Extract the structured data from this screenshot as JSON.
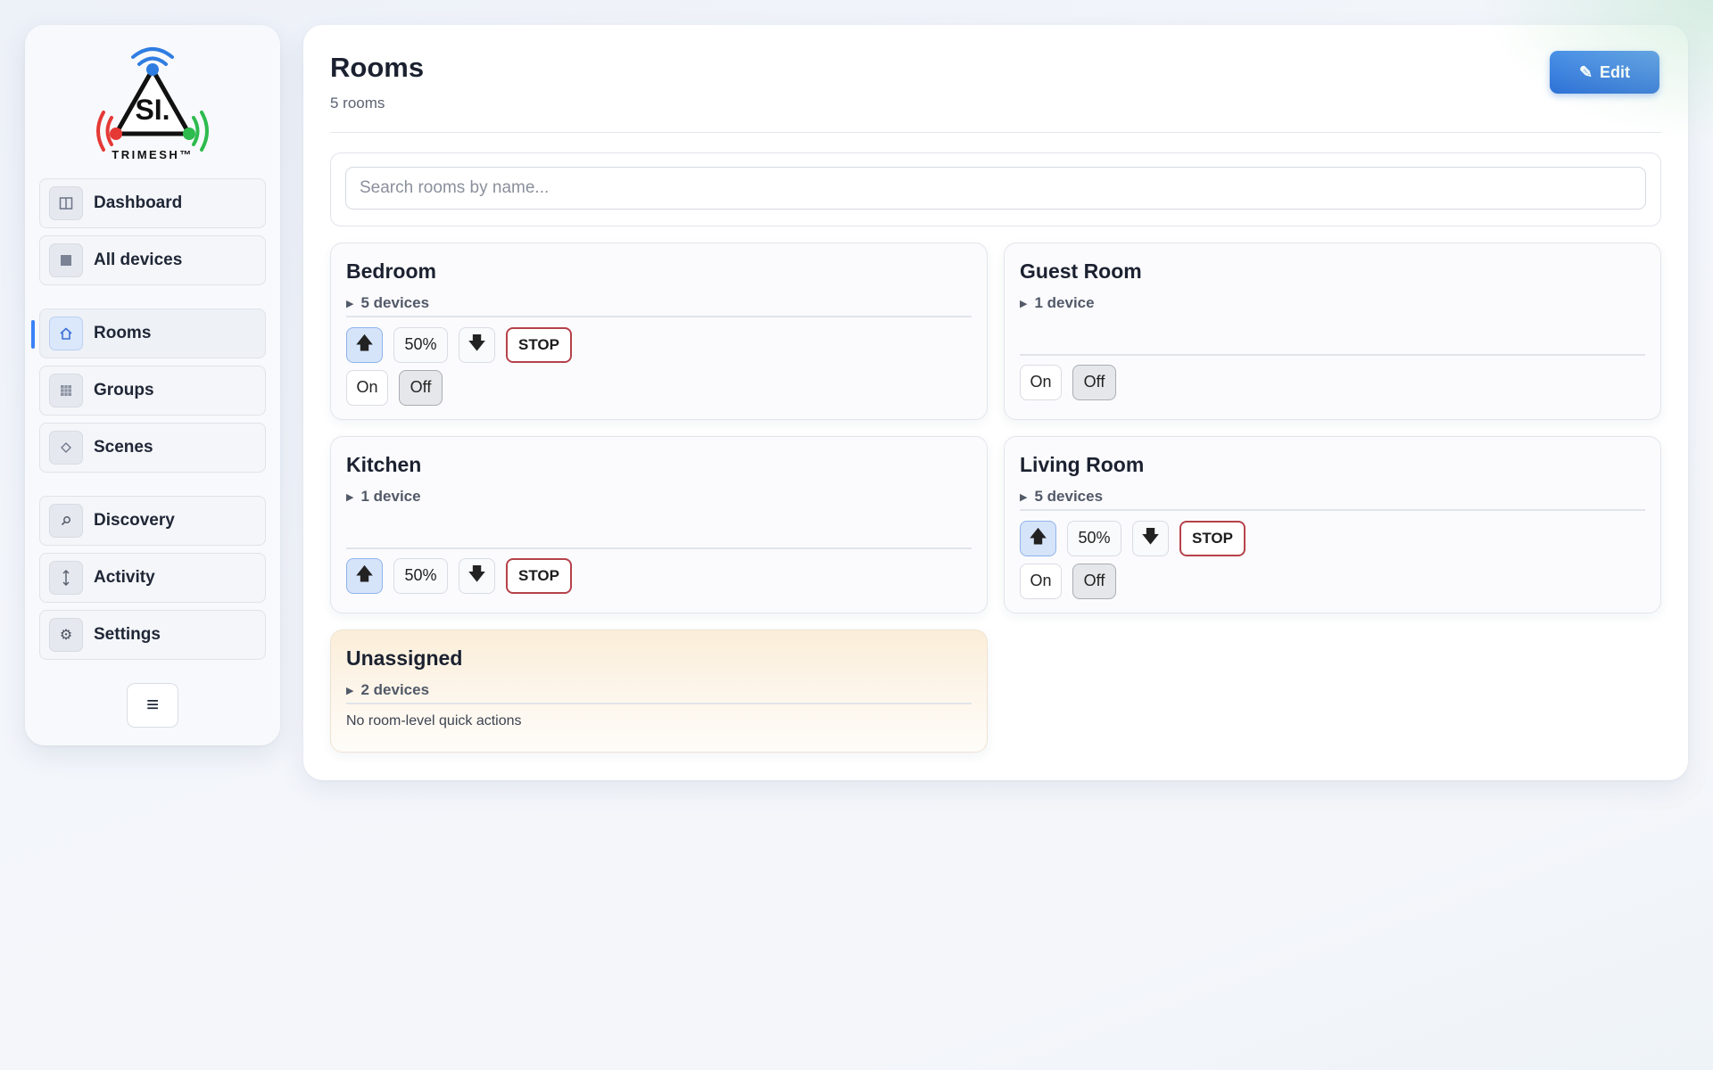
{
  "sidebar": {
    "logo_text": "SI.",
    "logo_brand": "TRIMESH™",
    "nav_primary": [
      {
        "label": "Dashboard",
        "icon": "columns-icon"
      },
      {
        "label": "All devices",
        "icon": "square-icon"
      }
    ],
    "nav_secondary": [
      {
        "label": "Rooms",
        "icon": "home-icon",
        "active": true
      },
      {
        "label": "Groups",
        "icon": "grid-icon"
      },
      {
        "label": "Scenes",
        "icon": "diamond-icon"
      }
    ],
    "nav_tertiary": [
      {
        "label": "Discovery",
        "icon": "search-icon"
      },
      {
        "label": "Activity",
        "icon": "updown-arrow-icon"
      },
      {
        "label": "Settings",
        "icon": "gear-icon"
      }
    ],
    "menu_icon": "hamburger-icon"
  },
  "header": {
    "title": "Rooms",
    "subtitle": "5 rooms",
    "edit_label": "Edit"
  },
  "search": {
    "placeholder": "Search rooms by name..."
  },
  "rooms": [
    {
      "name": "Bedroom",
      "devices": "5 devices",
      "position": "50%",
      "stop": "STOP",
      "on": "On",
      "off": "Off"
    },
    {
      "name": "Guest Room",
      "devices": "1 device",
      "on": "On",
      "off": "Off"
    },
    {
      "name": "Kitchen",
      "devices": "1 device",
      "position": "50%",
      "stop": "STOP"
    },
    {
      "name": "Living Room",
      "devices": "5 devices",
      "position": "50%",
      "stop": "STOP",
      "on": "On",
      "off": "Off"
    },
    {
      "name": "Unassigned",
      "devices": "2 devices",
      "note": "No room-level quick actions"
    }
  ],
  "colors": {
    "accent": "#2a6fd6",
    "stop_border": "#b5424a",
    "logo_blue": "#2f7de1",
    "logo_red": "#e53935",
    "logo_green": "#2dbb4e"
  }
}
